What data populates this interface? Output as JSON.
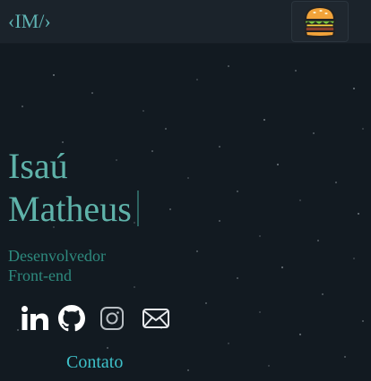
{
  "header": {
    "logo_text": "‹IM/›",
    "menu_icon": "hamburger-emoji-icon"
  },
  "hero": {
    "first_name": "Isaú",
    "last_name": "Matheus",
    "role_line1": "Desenvolvedor",
    "role_line2": "Front-end"
  },
  "social": [
    {
      "icon": "linkedin-icon"
    },
    {
      "icon": "github-icon"
    },
    {
      "icon": "instagram-icon"
    },
    {
      "icon": "mail-icon"
    }
  ],
  "contact_label": "Contato",
  "colors": {
    "background": "#121a21",
    "header": "#1b232b",
    "accent": "#5fb3aa",
    "role": "#2e8a7e",
    "link": "#3ec1c9"
  }
}
